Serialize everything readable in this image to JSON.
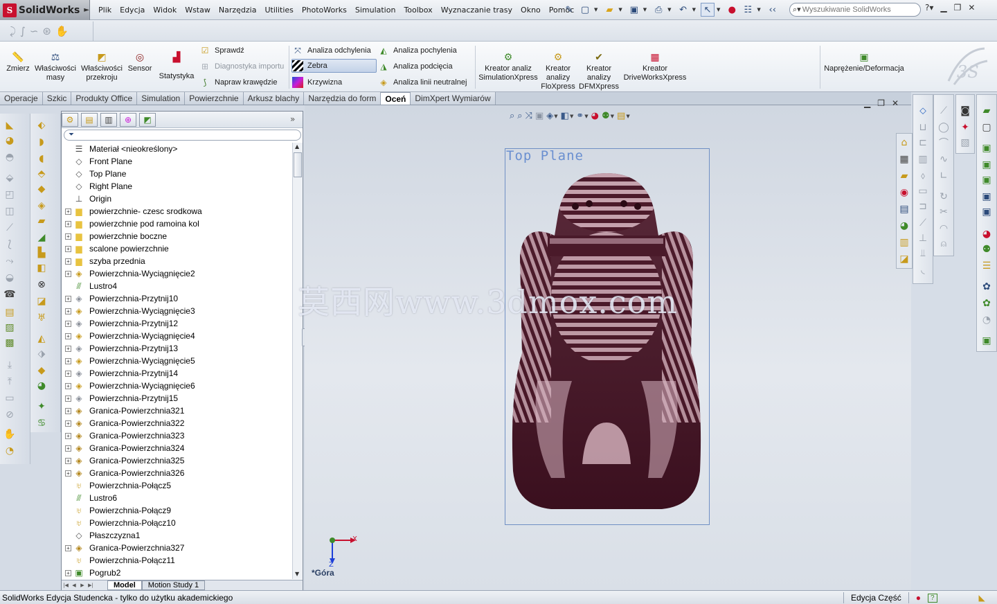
{
  "app": {
    "name": "SolidWorks",
    "logo_letter": "S"
  },
  "menu": [
    "Plik",
    "Edycja",
    "Widok",
    "Wstaw",
    "Narzędzia",
    "Utilities",
    "PhotoWorks",
    "Simulation",
    "Toolbox",
    "Wyznaczanie trasy",
    "Okno",
    "Pomoc"
  ],
  "search": {
    "placeholder": "Wyszukiwanie SolidWorks"
  },
  "command_manager": {
    "big": [
      {
        "label": "Zmierz"
      },
      {
        "label": "Właściwości masy"
      },
      {
        "label": "Właściwości przekroju"
      },
      {
        "label": "Sensor"
      },
      {
        "label": "Statystyka"
      }
    ],
    "group1": [
      {
        "label": "Sprawdź",
        "state": "normal"
      },
      {
        "label": "Diagnostyka importu",
        "state": "disabled"
      },
      {
        "label": "Napraw krawędzie",
        "state": "normal"
      }
    ],
    "group2": [
      {
        "label": "Analiza odchylenia",
        "state": "normal"
      },
      {
        "label": "Zebra",
        "state": "active"
      },
      {
        "label": "Krzywizna",
        "state": "normal"
      }
    ],
    "group3": [
      {
        "label": "Analiza pochylenia"
      },
      {
        "label": "Analiza podcięcia"
      },
      {
        "label": "Analiza linii neutralnej"
      }
    ],
    "wizards": [
      {
        "label": "Kreator analiz SimulationXpress"
      },
      {
        "label": "Kreator analizy FloXpress"
      },
      {
        "label": "Kreator analizy DFMXpress"
      },
      {
        "label": "Kreator DriveWorksXpress"
      }
    ],
    "stress": {
      "label": "Naprężenie/Deformacja"
    }
  },
  "tabs": [
    {
      "label": "Operacje",
      "active": false
    },
    {
      "label": "Szkic",
      "active": false
    },
    {
      "label": "Produkty Office",
      "active": false
    },
    {
      "label": "Simulation",
      "active": false
    },
    {
      "label": "Powierzchnie",
      "active": false
    },
    {
      "label": "Arkusz blachy",
      "active": false
    },
    {
      "label": "Narzędzia do form",
      "active": false
    },
    {
      "label": "Oceń",
      "active": true
    },
    {
      "label": "DimXpert Wymiarów",
      "active": false
    }
  ],
  "tree": [
    {
      "label": "Materiał <nieokreślony>",
      "icon": "material-icon",
      "expandable": false
    },
    {
      "label": "Front Plane",
      "icon": "plane-icon",
      "expandable": false
    },
    {
      "label": "Top Plane",
      "icon": "plane-icon",
      "expandable": false
    },
    {
      "label": "Right Plane",
      "icon": "plane-icon",
      "expandable": false
    },
    {
      "label": "Origin",
      "icon": "origin-icon",
      "expandable": false
    },
    {
      "label": "powierzchnie- czesc srodkowa",
      "icon": "folder-icon",
      "expandable": true
    },
    {
      "label": "powierzchnie pod ramoina kol",
      "icon": "folder-icon",
      "expandable": true
    },
    {
      "label": "powierzchnie boczne",
      "icon": "folder-icon",
      "expandable": true
    },
    {
      "label": "scalone powierzchnie",
      "icon": "folder-icon",
      "expandable": true
    },
    {
      "label": "szyba przednia",
      "icon": "folder-icon",
      "expandable": true
    },
    {
      "label": "Powierzchnia-Wyciągnięcie2",
      "icon": "extrude-surface-icon",
      "expandable": true
    },
    {
      "label": "Lustro4",
      "icon": "mirror-icon",
      "expandable": false
    },
    {
      "label": "Powierzchnia-Przytnij10",
      "icon": "trim-surface-icon",
      "expandable": true
    },
    {
      "label": "Powierzchnia-Wyciągnięcie3",
      "icon": "extrude-surface-icon",
      "expandable": true
    },
    {
      "label": "Powierzchnia-Przytnij12",
      "icon": "trim-surface-icon",
      "expandable": true
    },
    {
      "label": "Powierzchnia-Wyciągnięcie4",
      "icon": "extrude-surface-icon",
      "expandable": true
    },
    {
      "label": "Powierzchnia-Przytnij13",
      "icon": "trim-surface-icon",
      "expandable": true
    },
    {
      "label": "Powierzchnia-Wyciągnięcie5",
      "icon": "extrude-surface-icon",
      "expandable": true
    },
    {
      "label": "Powierzchnia-Przytnij14",
      "icon": "trim-surface-icon",
      "expandable": true
    },
    {
      "label": "Powierzchnia-Wyciągnięcie6",
      "icon": "extrude-surface-icon",
      "expandable": true
    },
    {
      "label": "Powierzchnia-Przytnij15",
      "icon": "trim-surface-icon",
      "expandable": true
    },
    {
      "label": "Granica-Powierzchnia321",
      "icon": "boundary-surface-icon",
      "expandable": true
    },
    {
      "label": "Granica-Powierzchnia322",
      "icon": "boundary-surface-icon",
      "expandable": true
    },
    {
      "label": "Granica-Powierzchnia323",
      "icon": "boundary-surface-icon",
      "expandable": true
    },
    {
      "label": "Granica-Powierzchnia324",
      "icon": "boundary-surface-icon",
      "expandable": true
    },
    {
      "label": "Granica-Powierzchnia325",
      "icon": "boundary-surface-icon",
      "expandable": true
    },
    {
      "label": "Granica-Powierzchnia326",
      "icon": "boundary-surface-icon",
      "expandable": true
    },
    {
      "label": "Powierzchnia-Połącz5",
      "icon": "knit-surface-icon",
      "expandable": false
    },
    {
      "label": "Lustro6",
      "icon": "mirror-icon",
      "expandable": false
    },
    {
      "label": "Powierzchnia-Połącz9",
      "icon": "knit-surface-icon",
      "expandable": false
    },
    {
      "label": "Powierzchnia-Połącz10",
      "icon": "knit-surface-icon",
      "expandable": false
    },
    {
      "label": "Płaszczyzna1",
      "icon": "plane-icon",
      "expandable": false
    },
    {
      "label": "Granica-Powierzchnia327",
      "icon": "boundary-surface-icon",
      "expandable": true
    },
    {
      "label": "Powierzchnia-Połącz11",
      "icon": "knit-surface-icon",
      "expandable": false
    },
    {
      "label": "Pogrub2",
      "icon": "thicken-icon",
      "expandable": true
    }
  ],
  "fm_bottom_tabs": [
    {
      "label": "Model",
      "active": true
    },
    {
      "label": "Motion Study 1",
      "active": false
    }
  ],
  "viewport": {
    "plane_label": "Top Plane",
    "view_name": "*Góra",
    "triad_x": "X",
    "triad_z": "Z",
    "watermark": "莫西网www.3dmox.com"
  },
  "status": {
    "text": "SolidWorks Edycja Studencka - tylko do użytku akademickiego",
    "mode": "Edycja Część",
    "help": "?"
  },
  "colors": {
    "accent": "#c8102e",
    "zebra_dark": "#3a0f1e",
    "zebra_light": "#d9b7c2"
  }
}
